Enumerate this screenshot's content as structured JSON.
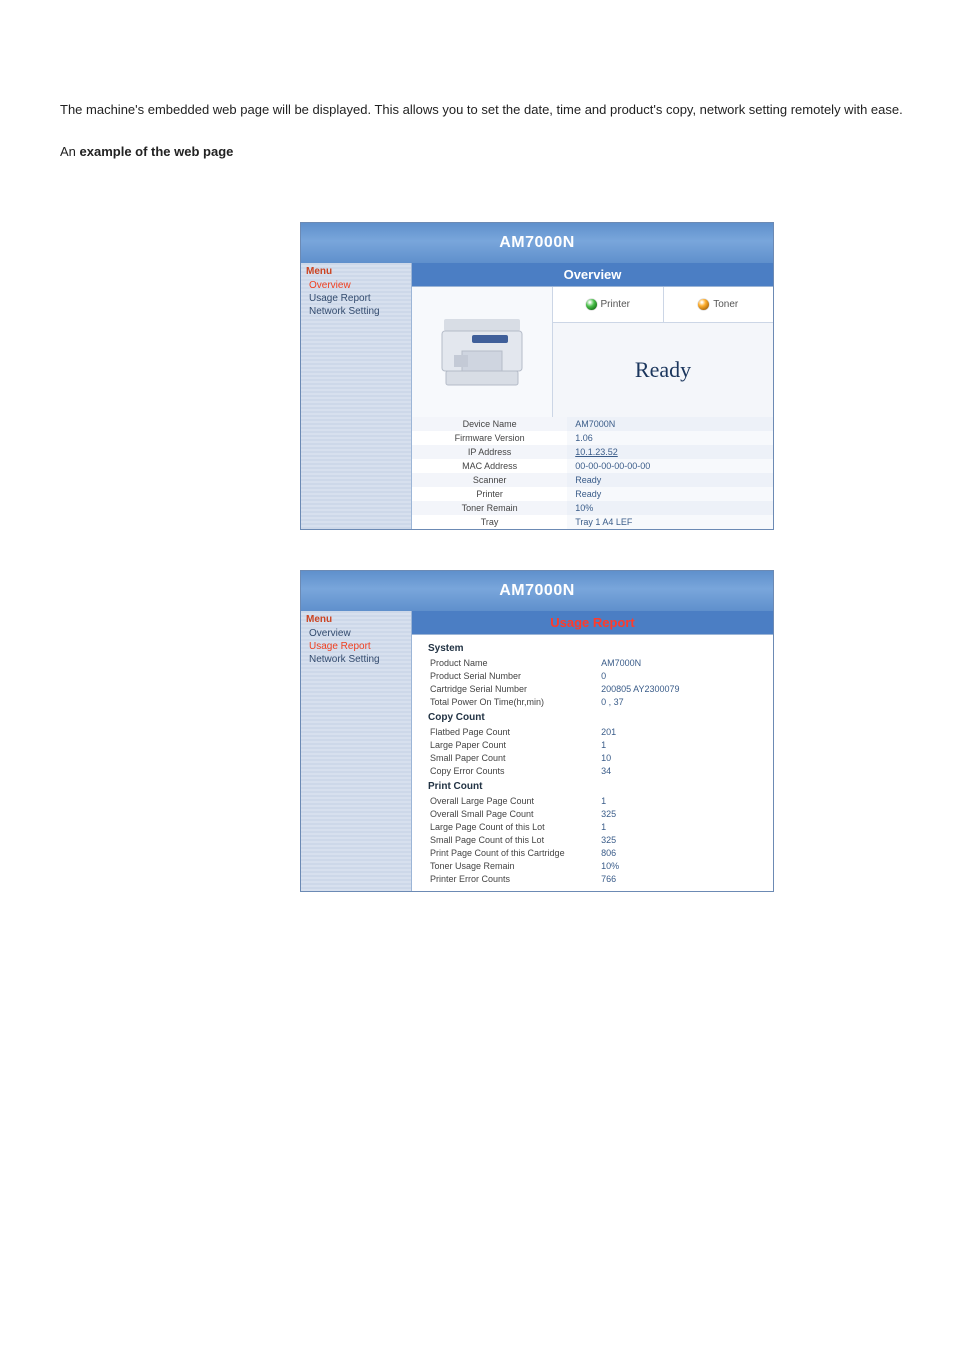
{
  "page_intro": {
    "line1_text": "The machine's embedded web page will be displayed. This allows you to set the date, time and product's copy, network setting remotely with ease.",
    "line2": "example of the web page",
    "line2_prefix": "An "
  },
  "shot1": {
    "title": "AM7000N",
    "menu_header": "Menu",
    "menu": [
      "Overview",
      "Usage Report",
      "Network Setting"
    ],
    "active_index": 0,
    "section_header": "Overview",
    "indicators": {
      "printer": "Printer",
      "toner": "Toner"
    },
    "ready_text": "Ready",
    "specs": [
      {
        "label": "Device Name",
        "value": "AM7000N"
      },
      {
        "label": "Firmware Version",
        "value": "1.06"
      },
      {
        "label": "IP Address",
        "value": "10.1.23.52",
        "link": true
      },
      {
        "label": "MAC Address",
        "value": "00-00-00-00-00-00"
      },
      {
        "label": "Scanner",
        "value": "Ready"
      },
      {
        "label": "Printer",
        "value": "Ready"
      },
      {
        "label": "Toner Remain",
        "value": "10%"
      },
      {
        "label": "Tray",
        "value": "Tray 1 A4 LEF"
      }
    ]
  },
  "shot2": {
    "title": "AM7000N",
    "menu_header": "Menu",
    "menu": [
      "Overview",
      "Usage Report",
      "Network Setting"
    ],
    "active_index": 1,
    "section_header": "Usage Report",
    "groups": [
      {
        "header": "System",
        "rows": [
          {
            "label": "Product Name",
            "value": "AM7000N"
          },
          {
            "label": "Product Serial Number",
            "value": "0"
          },
          {
            "label": "Cartridge Serial Number",
            "value": "200805 AY2300079"
          },
          {
            "label": "Total Power On Time(hr,min)",
            "value": "0 , 37"
          }
        ]
      },
      {
        "header": "Copy Count",
        "rows": [
          {
            "label": "Flatbed Page Count",
            "value": "201"
          },
          {
            "label": "Large Paper Count",
            "value": "1"
          },
          {
            "label": "Small Paper Count",
            "value": "10"
          },
          {
            "label": "Copy Error Counts",
            "value": "34"
          }
        ]
      },
      {
        "header": "Print Count",
        "rows": [
          {
            "label": "Overall Large Page Count",
            "value": "1"
          },
          {
            "label": "Overall Small Page Count",
            "value": "325"
          },
          {
            "label": "Large Page Count of this Lot",
            "value": "1"
          },
          {
            "label": "Small Page Count of this Lot",
            "value": "325"
          },
          {
            "label": "Print Page Count of this Cartridge",
            "value": "806"
          },
          {
            "label": "Toner Usage Remain",
            "value": "10%"
          },
          {
            "label": "Printer Error Counts",
            "value": "766"
          }
        ]
      }
    ]
  }
}
